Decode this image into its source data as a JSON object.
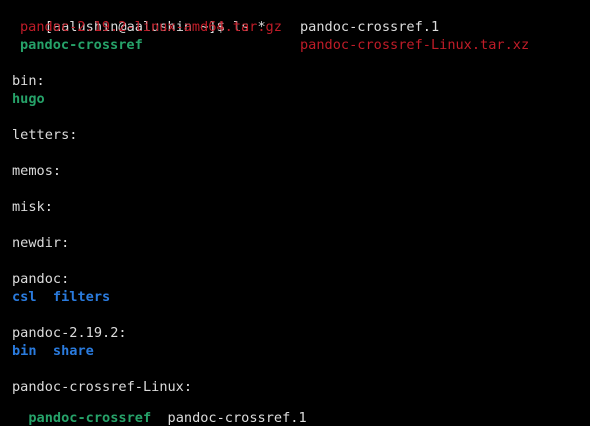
{
  "prompt": {
    "text": "[aalushin@aalushin ~]$ ls *"
  },
  "root_listing": {
    "row1": [
      {
        "name": "pandoc-2.19.2-linux-amd64.tar.gz",
        "type": "archive"
      },
      {
        "name": "pandoc-crossref.1",
        "type": "file"
      }
    ],
    "row2": [
      {
        "name": "pandoc-crossref",
        "type": "executable"
      },
      {
        "name": "pandoc-crossref-Linux.tar.xz",
        "type": "archive"
      }
    ]
  },
  "dirs": [
    {
      "header": "bin:",
      "entries": [
        "hugo"
      ],
      "entry_type": "executable"
    },
    {
      "header": "letters:",
      "entries": []
    },
    {
      "header": "memos:",
      "entries": []
    },
    {
      "header": "misk:",
      "entries": []
    },
    {
      "header": "newdir:",
      "entries": []
    },
    {
      "header": "pandoc:",
      "entries_line": "csl  filters",
      "entry_type": "directory"
    },
    {
      "header": "pandoc-2.19.2:",
      "entries_line": "bin  share",
      "entry_type": "directory"
    },
    {
      "header": "pandoc-crossref-Linux:",
      "entries": [
        "pandoc-crossref",
        "pandoc-crossref.1"
      ]
    }
  ],
  "colors": {
    "background": "#000000",
    "text": "#dcdcdc",
    "archive": "#c01c28",
    "executable": "#26a269",
    "directory": "#2a7bde"
  }
}
